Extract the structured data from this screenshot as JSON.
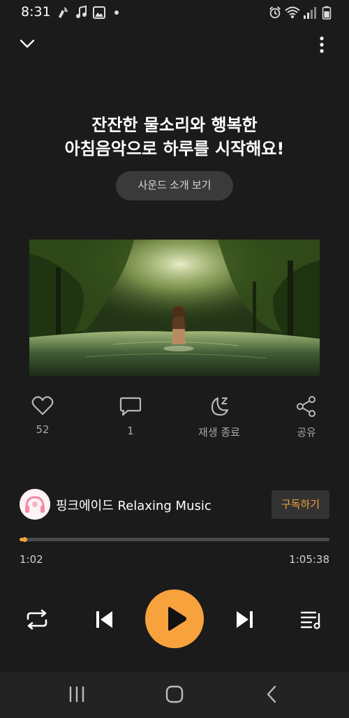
{
  "status_bar": {
    "time": "8:31",
    "icons": [
      "phone-wave-icon",
      "music-note-icon",
      "image-icon",
      "dot-icon",
      "alarm-icon",
      "wifi-icon",
      "signal-icon",
      "battery-icon"
    ]
  },
  "top_bar": {
    "collapse_icon": "chevron-down-icon",
    "more_icon": "more-vertical-icon"
  },
  "content": {
    "title_line1": "잔잔한 물소리와 행복한",
    "title_line2": "아침음악으로 하루를 시작해요!",
    "intro_button": "사운드 소개 보기"
  },
  "actions": [
    {
      "icon": "heart-icon",
      "label": "52"
    },
    {
      "icon": "comment-icon",
      "label": "1"
    },
    {
      "icon": "sleep-timer-icon",
      "label": "재생 종료"
    },
    {
      "icon": "share-icon",
      "label": "공유"
    }
  ],
  "channel": {
    "name": "핑크에이드 Relaxing Music",
    "subscribe_label": "구독하기"
  },
  "player": {
    "current_time": "1:02",
    "total_time": "1:05:38",
    "progress_fraction": 0.016
  },
  "colors": {
    "accent": "#f7a23d",
    "background": "#1b1b1b",
    "button_bg": "#3a3a3a"
  }
}
